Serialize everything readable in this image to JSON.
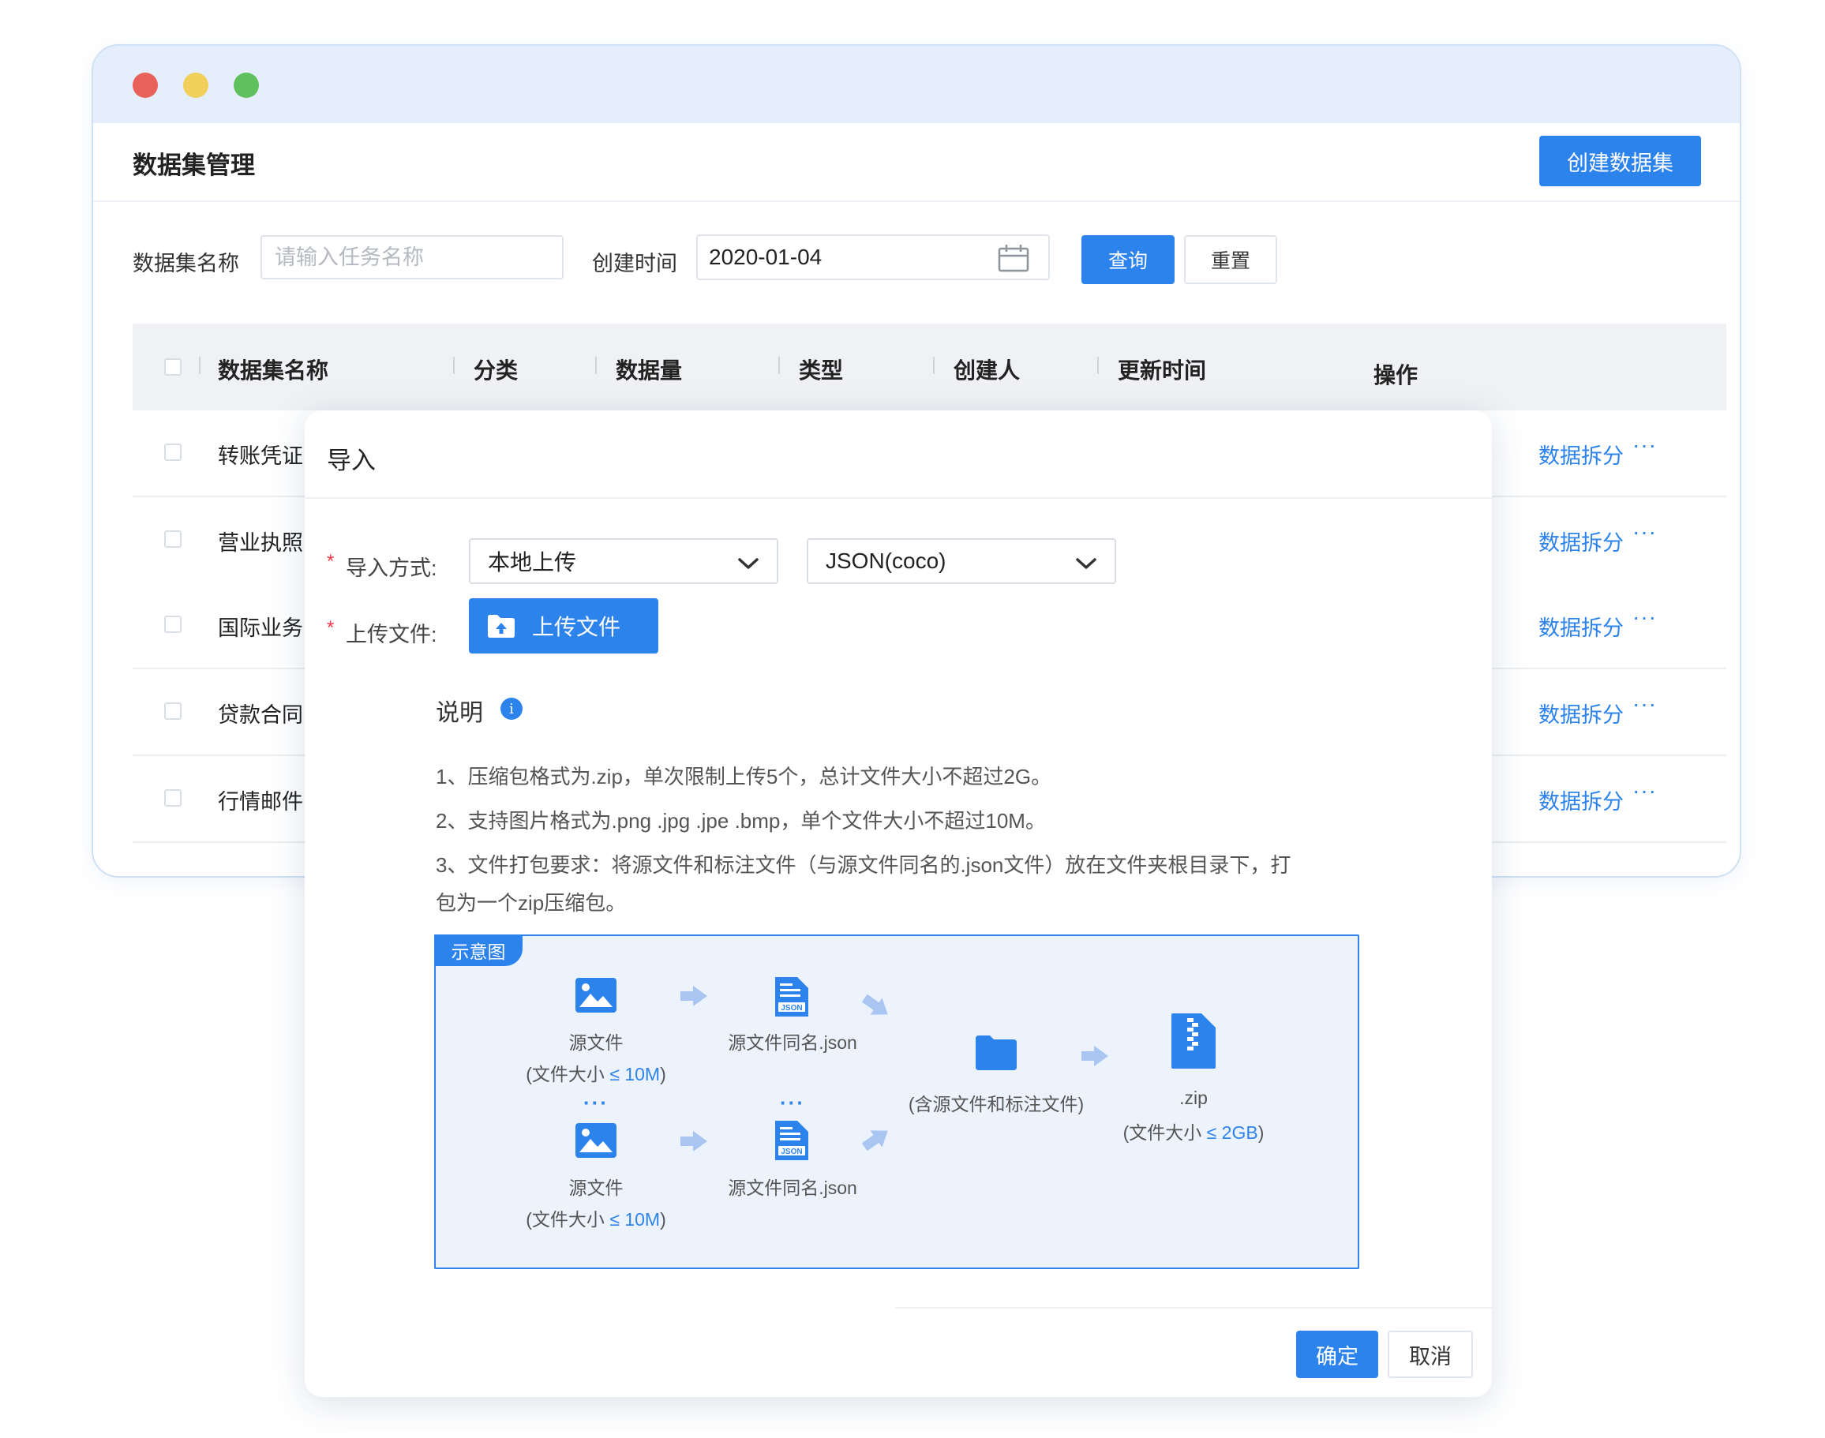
{
  "window": {
    "traffic_lights": [
      "#e8625a",
      "#f2cf5a",
      "#5fc05e"
    ]
  },
  "header": {
    "title": "数据集管理",
    "create_button": "创建数据集"
  },
  "filters": {
    "name_label": "数据集名称",
    "name_placeholder": "请输入任务名称",
    "time_label": "创建时间",
    "time_value": "2020-01-04",
    "query_button": "查询",
    "reset_button": "重置"
  },
  "table": {
    "columns": [
      "数据集名称",
      "分类",
      "数据量",
      "类型",
      "创建人",
      "更新时间",
      "操作"
    ],
    "rows": [
      {
        "name": "转账凭证",
        "action": "数据拆分",
        "more": "···"
      },
      {
        "name": "营业执照",
        "action": "数据拆分",
        "more": "···"
      },
      {
        "name": "国际业务",
        "action": "数据拆分",
        "more": "···"
      },
      {
        "name": "贷款合同",
        "action": "数据拆分",
        "more": "···"
      },
      {
        "name": "行情邮件",
        "action": "数据拆分",
        "more": "···"
      }
    ]
  },
  "modal": {
    "title": "导入",
    "required_mark": "*",
    "method_label": "导入方式:",
    "method_value": "本地上传",
    "format_value": "JSON(coco)",
    "file_label": "上传文件:",
    "upload_button": "上传文件",
    "note_title": "说明",
    "info_icon": "i",
    "notes": [
      "1、压缩包格式为.zip，单次限制上传5个，总计文件大小不超过2G。",
      "2、支持图片格式为.png .jpg .jpe .bmp，单个文件大小不超过10M。",
      "3、文件打包要求：将源文件和标注文件（与源文件同名的.json文件）放在文件夹根目录下，打",
      "包为一个zip压缩包。"
    ],
    "diagram": {
      "tag": "示意图",
      "source_label": "源文件",
      "source_size_prefix": "(文件大小 ",
      "source_size_value": "≤ 10M",
      "size_suffix": ")",
      "json_label": "源文件同名.json",
      "json_badge": "JSON",
      "ellipsis": "···",
      "folder_label": "(含源文件和标注文件)",
      "zip_label": ".zip",
      "zip_size_prefix": "(文件大小 ",
      "zip_size_value": "≤ 2GB"
    },
    "confirm_button": "确定",
    "cancel_button": "取消"
  },
  "colors": {
    "primary": "#2d83ec",
    "titlebar": "#e4eefc",
    "diagram_bg": "#edf3fd"
  }
}
